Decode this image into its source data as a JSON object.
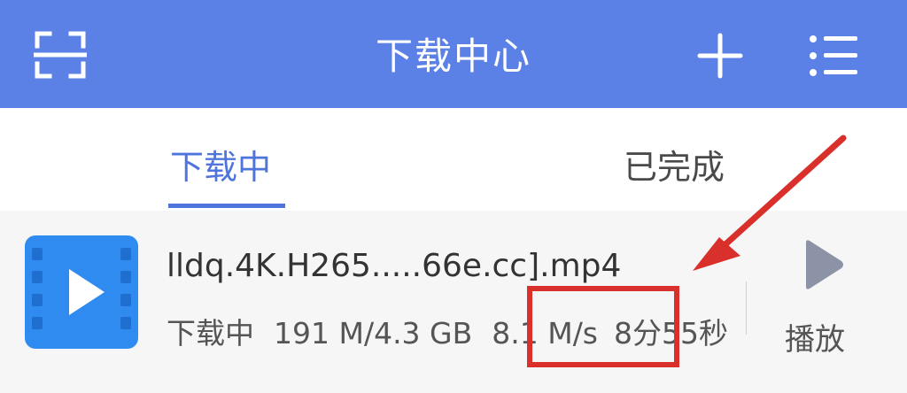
{
  "header": {
    "title": "下载中心",
    "background": "#5b80e6",
    "left_icon": "scan-icon",
    "right_icons": [
      "add-icon",
      "menu-list-icon"
    ]
  },
  "tabs": [
    {
      "label": "下载中",
      "active": true,
      "color": "#4e75dd"
    },
    {
      "label": "已完成",
      "active": false
    }
  ],
  "downloads": [
    {
      "icon": "video-file-icon",
      "file_name": "lldq.4K.H265.....66e.cc].mp4",
      "status": "下载中",
      "size_progress": "191 M/4.3 GB",
      "speed": "8.1 M/s",
      "remaining": "8分55秒",
      "action_label": "播放",
      "action_icon": "play-icon"
    }
  ],
  "annotation": {
    "color": "#d9302b",
    "highlight_target": "speed"
  }
}
